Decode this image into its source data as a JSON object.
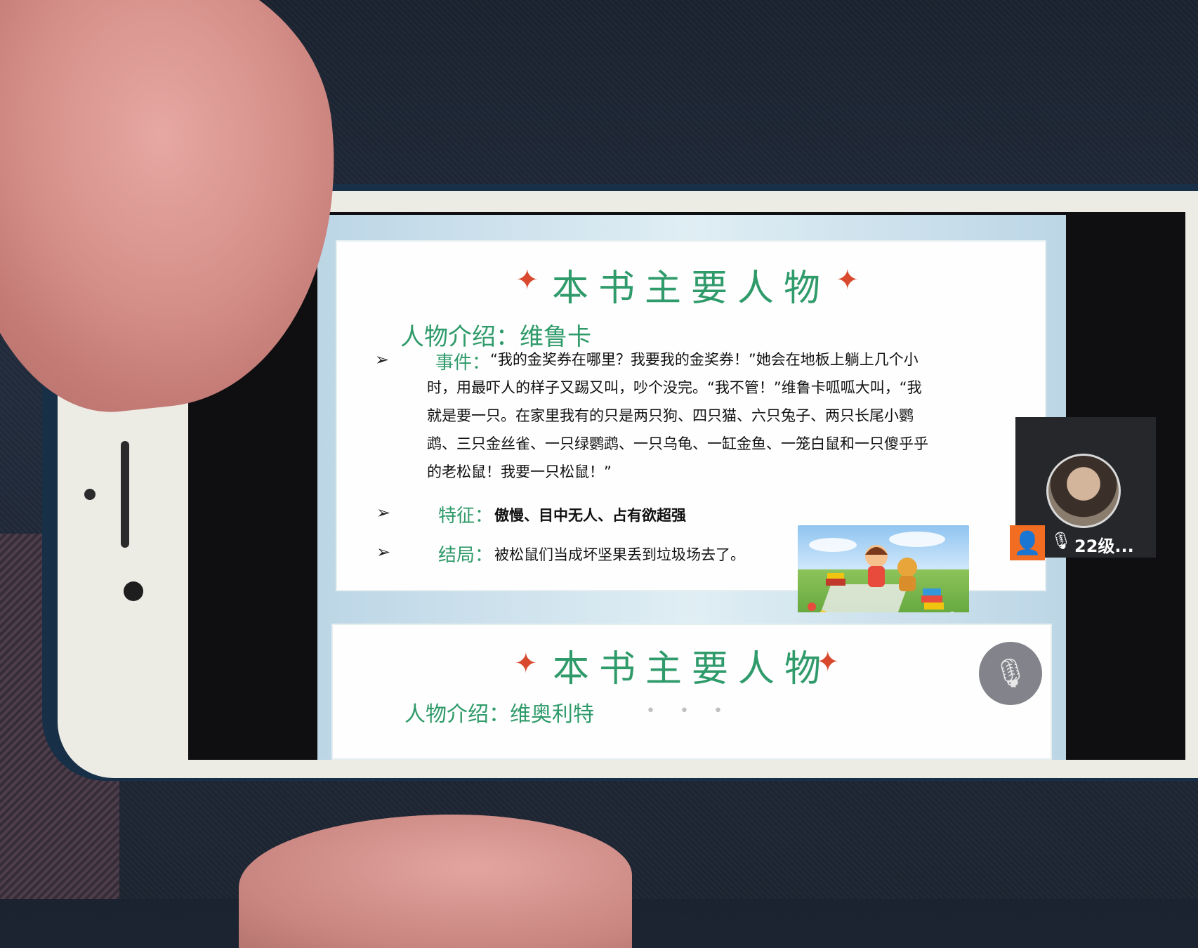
{
  "slide1": {
    "title": "本书主要人物",
    "intro": "人物介绍：维鲁卡",
    "event_label": "事件：",
    "event_lines": [
      "“我的金奖券在哪里？我要我的金奖券！”她会在地板上躺上几个小",
      "时，用最吓人的样子又踢又叫，吵个没完。“我不管！”维鲁卡呱呱大叫，“我",
      "就是要一只。在家里我有的只是两只狗、四只猫、六只兔子、两只长尾小鹦",
      "鹉、三只金丝雀、一只绿鹦鹉、一只乌龟、一缸金鱼、一笼白鼠和一只傻乎乎",
      "的老松鼠！我要一只松鼠！”"
    ],
    "trait_label": "特征：",
    "trait_value": "傲慢、目中无人、占有欲超强",
    "ending_label": "结局：",
    "ending_value": "被松鼠们当成坏坚果丢到垃圾场去了。"
  },
  "slide2": {
    "title": "本书主要人物",
    "intro": "人物介绍：维奥利特",
    "dots": "• • •"
  },
  "participant": {
    "name": "22级..."
  },
  "icons": {
    "bullet": "➢",
    "bird": "✦",
    "user_badge": "👤",
    "mic": "🎙",
    "mute": "🎙"
  }
}
